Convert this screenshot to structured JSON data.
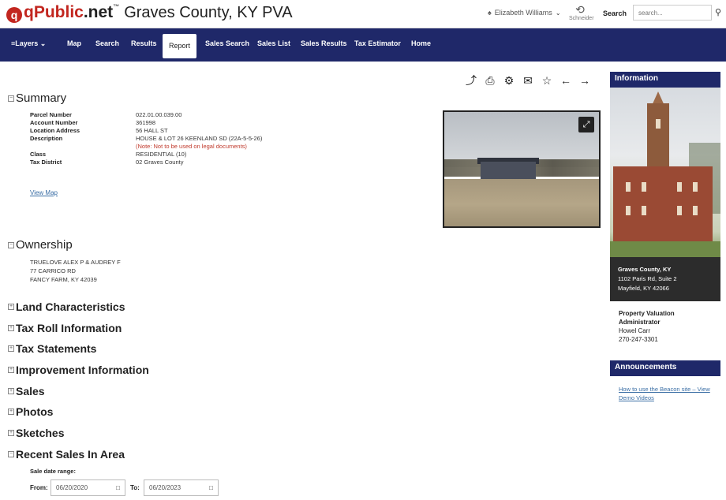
{
  "header": {
    "logo_mark": "q",
    "logo_text": "qPublic",
    "logo_net": ".net",
    "logo_tm": "™",
    "county_title": "Graves County, KY PVA",
    "user_name": "Elizabeth Williams",
    "user_chevron": "⌄",
    "schneider_label": "Schneider",
    "search_label": "Search",
    "search_placeholder": "search..."
  },
  "nav": {
    "layers": "≡Layers ⌄",
    "items": [
      "Map",
      "Search",
      "Results",
      "Report",
      "Sales Search",
      "Sales List",
      "Sales Results",
      "Tax Estimator",
      "Home"
    ],
    "active": "Report"
  },
  "summary": {
    "title": "Summary",
    "rows": [
      {
        "k": "Parcel Number",
        "v": "022.01.00.039.00"
      },
      {
        "k": "Account Number",
        "v": "361998"
      },
      {
        "k": "Location Address",
        "v": "56 HALL ST"
      },
      {
        "k": "Description",
        "v": "HOUSE & LOT 26 KEENLAND SD (22A-5-5-26)"
      },
      {
        "k": "",
        "v": "(Note: Not to be used on legal documents)"
      },
      {
        "k": "Class",
        "v": "RESIDENTIAL (10)"
      },
      {
        "k": "Tax District",
        "v": "02 Graves County"
      }
    ],
    "view_map": "View Map"
  },
  "ownership": {
    "title": "Ownership",
    "lines": [
      "TRUELOVE ALEX P & AUDREY F",
      "77 CARRICO RD",
      "FANCY FARM, KY 42039"
    ]
  },
  "sections": [
    "Land Characteristics",
    "Tax Roll Information",
    "Tax Statements",
    "Improvement Information",
    "Sales",
    "Photos",
    "Sketches",
    "Recent Sales In Area"
  ],
  "recent_sales": {
    "range_label": "Sale date range:",
    "from_label": "From:",
    "from_value": "06/20/2020",
    "to_label": "To:",
    "to_value": "06/20/2023"
  },
  "sidebar": {
    "info_title": "Information",
    "caption_county": "Graves County, KY",
    "caption_addr1": "1102 Paris Rd, Suite 2",
    "caption_addr2": "Mayfield, KY 42066",
    "pva_title1": "Property Valuation",
    "pva_title2": "Administrator",
    "pva_name": "Howel Carr",
    "pva_phone": "270-247-3301",
    "ann_title": "Announcements",
    "ann_link": "How to use the Beacon site – View Demo Videos"
  },
  "colors": {
    "nav_bg": "#1f2869",
    "logo_red": "#c2261f",
    "link": "#3a6ea5",
    "note_red": "#c0392b"
  }
}
